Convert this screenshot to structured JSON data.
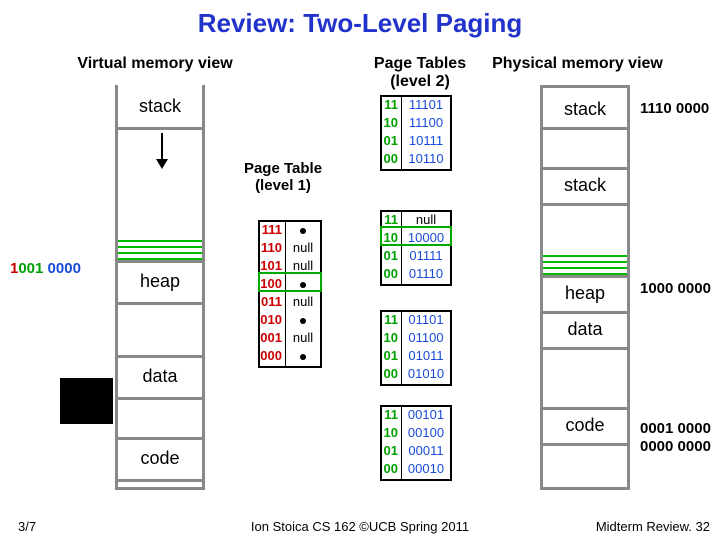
{
  "title": "Review: Two-Level Paging",
  "labels": {
    "virtual": "Virtual memory view",
    "physical": "Physical memory view",
    "pt1": "Page Table\n(level 1)",
    "pt2": "Page Tables\n(level 2)"
  },
  "virtual_segments": {
    "stack": "stack",
    "heap": "heap",
    "data": "data",
    "code": "code"
  },
  "physical_segments": {
    "stack1": "stack",
    "stack2": "stack",
    "heap": "heap",
    "data": "data",
    "code": "code"
  },
  "virtual_addr": {
    "r": "1",
    "g": "001",
    "b": "0000",
    "full": "1001 0000"
  },
  "phys_addr1": "1110 0000",
  "phys_addr2": "1000 0000",
  "phys_addr3a": "0001 0000",
  "phys_addr3b": "0000 0000",
  "pt1_rows": [
    {
      "idx": "111",
      "val": "•"
    },
    {
      "idx": "110",
      "val": "null"
    },
    {
      "idx": "101",
      "val": "null"
    },
    {
      "idx": "100",
      "val": "•"
    },
    {
      "idx": "011",
      "val": "null"
    },
    {
      "idx": "010",
      "val": "•"
    },
    {
      "idx": "001",
      "val": "null"
    },
    {
      "idx": "000",
      "val": "•"
    }
  ],
  "pt2_tables": [
    [
      {
        "idx": "11",
        "val": "11101"
      },
      {
        "idx": "10",
        "val": "11100"
      },
      {
        "idx": "01",
        "val": "10111"
      },
      {
        "idx": "00",
        "val": "10110"
      }
    ],
    [
      {
        "idx": "11",
        "val": "null"
      },
      {
        "idx": "10",
        "val": "10000"
      },
      {
        "idx": "01",
        "val": "01111"
      },
      {
        "idx": "00",
        "val": "01110"
      }
    ],
    [
      {
        "idx": "11",
        "val": "01101"
      },
      {
        "idx": "10",
        "val": "01100"
      },
      {
        "idx": "01",
        "val": "01011"
      },
      {
        "idx": "00",
        "val": "01010"
      }
    ],
    [
      {
        "idx": "11",
        "val": "00101"
      },
      {
        "idx": "10",
        "val": "00100"
      },
      {
        "idx": "01",
        "val": "00011"
      },
      {
        "idx": "00",
        "val": "00010"
      }
    ]
  ],
  "footer": {
    "left": "3/7",
    "center": "Ion Stoica CS 162 ©UCB Spring 2011",
    "right": "Midterm Review. 32"
  }
}
